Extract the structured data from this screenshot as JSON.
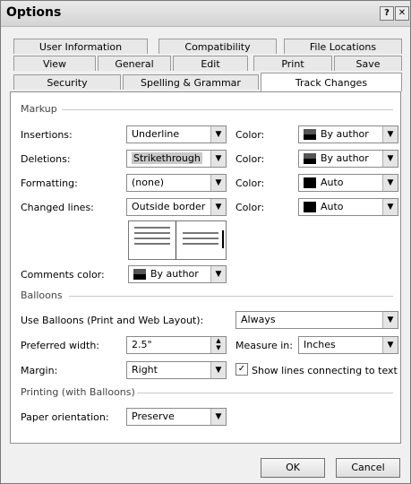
{
  "dialog": {
    "title": "Options",
    "help_glyph": "?",
    "close_glyph": "✕"
  },
  "tabs": {
    "row1": [
      "User Information",
      "Compatibility",
      "File Locations"
    ],
    "row2": [
      "View",
      "General",
      "Edit",
      "Print",
      "Save"
    ],
    "row3": [
      "Security",
      "Spelling & Grammar",
      "Track Changes"
    ],
    "active": "Track Changes"
  },
  "markup": {
    "section": "Markup",
    "insertions": {
      "label": "Insertions:",
      "value": "Underline",
      "color_label": "Color:",
      "color_value": "By author"
    },
    "deletions": {
      "label": "Deletions:",
      "value": "Strikethrough",
      "color_label": "Color:",
      "color_value": "By author"
    },
    "formatting": {
      "label": "Formatting:",
      "value": "(none)",
      "color_label": "Color:",
      "color_value": "Auto"
    },
    "changed_lines": {
      "label": "Changed lines:",
      "value": "Outside border",
      "color_label": "Color:",
      "color_value": "Auto"
    },
    "comments_color": {
      "label": "Comments color:",
      "value": "By author"
    }
  },
  "balloons": {
    "section": "Balloons",
    "use_label": "Use Balloons (Print and Web Layout):",
    "use_value": "Always",
    "width_label": "Preferred width:",
    "width_value": "2.5\"",
    "measure_label": "Measure in:",
    "measure_value": "Inches",
    "margin_label": "Margin:",
    "margin_value": "Right",
    "show_lines_label": "Show lines connecting to text",
    "show_lines_checked": true
  },
  "printing": {
    "section": "Printing (with Balloons)",
    "paper_label": "Paper orientation:",
    "paper_value": "Preserve"
  },
  "buttons": {
    "ok": "OK",
    "cancel": "Cancel"
  },
  "icons": {
    "dropdown": "chevron-down-icon",
    "spinner": "spinner-icon",
    "check": "check-icon"
  }
}
